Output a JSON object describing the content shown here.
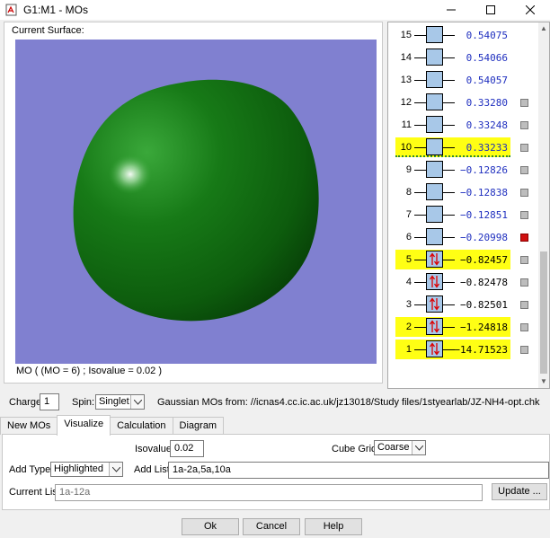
{
  "window": {
    "title": "G1:M1 - MOs",
    "icon": "gaussview-icon"
  },
  "surface": {
    "label": "Current Surface:",
    "info": "MO ( (MO = 6) ; Isovalue = 0.02 )",
    "background_color": "#8080d0",
    "lobe_color": "#1a7a1a"
  },
  "orbitals": [
    {
      "num": "15",
      "energy": "0.54075",
      "occupied": false,
      "highlight": false,
      "checkbox": "none"
    },
    {
      "num": "14",
      "energy": "0.54066",
      "occupied": false,
      "highlight": false,
      "checkbox": "none"
    },
    {
      "num": "13",
      "energy": "0.54057",
      "occupied": false,
      "highlight": false,
      "checkbox": "none"
    },
    {
      "num": "12",
      "energy": "0.33280",
      "occupied": false,
      "highlight": false,
      "checkbox": "gray"
    },
    {
      "num": "11",
      "energy": "0.33248",
      "occupied": false,
      "highlight": false,
      "checkbox": "gray"
    },
    {
      "num": "10",
      "energy": "0.33233",
      "occupied": false,
      "highlight": true,
      "checkbox": "gray",
      "dotted": true
    },
    {
      "num": "9",
      "energy": "−0.12826",
      "occupied": false,
      "highlight": false,
      "checkbox": "gray"
    },
    {
      "num": "8",
      "energy": "−0.12838",
      "occupied": false,
      "highlight": false,
      "checkbox": "gray"
    },
    {
      "num": "7",
      "energy": "−0.12851",
      "occupied": false,
      "highlight": false,
      "checkbox": "gray"
    },
    {
      "num": "6",
      "energy": "−0.20998",
      "occupied": false,
      "highlight": false,
      "checkbox": "red"
    },
    {
      "num": "5",
      "energy": "−0.82457",
      "occupied": true,
      "highlight": true,
      "checkbox": "gray"
    },
    {
      "num": "4",
      "energy": "−0.82478",
      "occupied": true,
      "highlight": false,
      "checkbox": "gray"
    },
    {
      "num": "3",
      "energy": "−0.82501",
      "occupied": true,
      "highlight": false,
      "checkbox": "gray"
    },
    {
      "num": "2",
      "energy": "−1.24818",
      "occupied": true,
      "highlight": true,
      "checkbox": "gray"
    },
    {
      "num": "1",
      "energy": "−14.71523",
      "occupied": true,
      "highlight": true,
      "checkbox": "gray"
    }
  ],
  "controls": {
    "charge_label": "Charge:",
    "charge_value": "1",
    "spin_label": "Spin:",
    "spin_value": "Singlet",
    "source_text": "Gaussian MOs from:  //icnas4.cc.ic.ac.uk/jz13018/Study files/1styearlab/JZ-NH4-opt.chk"
  },
  "tabs": [
    "New MOs",
    "Visualize",
    "Calculation",
    "Diagram"
  ],
  "visualize": {
    "isovalue_label": "Isovalue:",
    "isovalue_value": "0.02",
    "cube_grid_label": "Cube Grid:",
    "cube_grid_value": "Coarse",
    "add_type_label": "Add Type:",
    "add_type_value": "Highlighted",
    "add_list_label": "Add List:",
    "add_list_value": "1a-2a,5a,10a",
    "current_list_label": "Current List:",
    "current_list_value": "1a-12a",
    "update_label": "Update ..."
  },
  "footer": {
    "ok": "Ok",
    "cancel": "Cancel",
    "help": "Help"
  }
}
